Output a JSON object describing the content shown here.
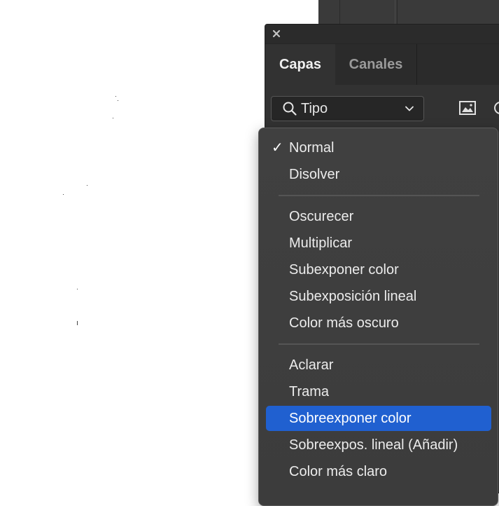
{
  "panel": {
    "tabs": [
      {
        "label": "Capas",
        "active": true
      },
      {
        "label": "Canales",
        "active": false
      }
    ],
    "filter": {
      "value": "Tipo"
    }
  },
  "blend_menu": {
    "groups": [
      [
        {
          "label": "Normal",
          "checked": true
        },
        {
          "label": "Disolver"
        }
      ],
      [
        {
          "label": "Oscurecer"
        },
        {
          "label": "Multiplicar"
        },
        {
          "label": "Subexponer color"
        },
        {
          "label": "Subexposición lineal"
        },
        {
          "label": "Color más oscuro"
        }
      ],
      [
        {
          "label": "Aclarar"
        },
        {
          "label": "Trama"
        },
        {
          "label": "Sobreexponer color",
          "highlighted": true
        },
        {
          "label": "Sobreexpos. lineal (Añadir)"
        },
        {
          "label": "Color más claro"
        }
      ]
    ]
  },
  "colors": {
    "highlight": "#2060d0",
    "panel_bg": "#323232",
    "menu_bg": "#404040"
  }
}
